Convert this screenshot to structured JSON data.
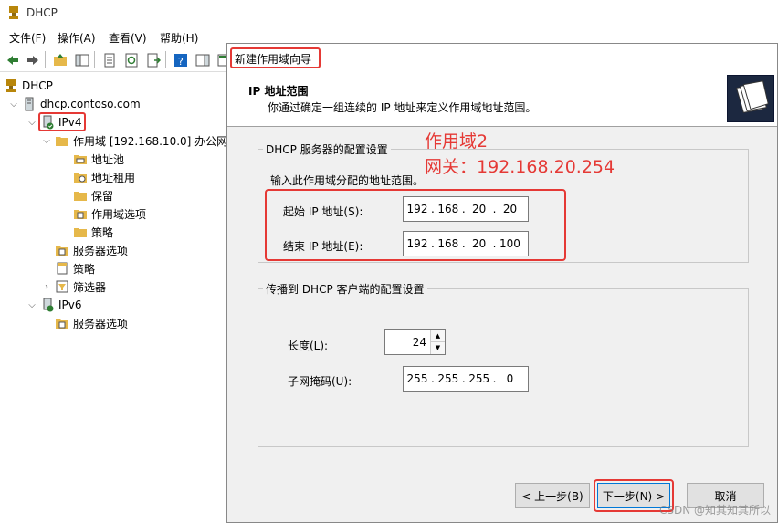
{
  "window": {
    "title": "DHCP"
  },
  "menu": [
    "文件(F)",
    "操作(A)",
    "查看(V)",
    "帮助(H)"
  ],
  "tree": {
    "root": "DHCP",
    "server": "dhcp.contoso.com",
    "ipv4": "IPv4",
    "scope": "作用域 [192.168.10.0] 办公网",
    "scope_children": [
      "地址池",
      "地址租用",
      "保留",
      "作用域选项",
      "策略"
    ],
    "ipv4_children": [
      "服务器选项",
      "策略",
      "筛选器"
    ],
    "ipv6": "IPv6",
    "ipv6_children": [
      "服务器选项"
    ]
  },
  "wizard": {
    "title": "新建作用域向导",
    "header_title": "IP 地址范围",
    "header_desc": "你通过确定一组连续的 IP 地址来定义作用域地址范围。",
    "group1_legend": "DHCP 服务器的配置设置",
    "group1_instruction": "输入此作用域分配的地址范围。",
    "start_ip_label": "起始 IP 地址(S):",
    "start_ip": [
      "192",
      "168",
      "20",
      "20"
    ],
    "end_ip_label": "结束 IP 地址(E):",
    "end_ip": [
      "192",
      "168",
      "20",
      "100"
    ],
    "group2_legend": "传播到 DHCP 客户端的配置设置",
    "length_label": "长度(L):",
    "length_value": "24",
    "mask_label": "子网掩码(U):",
    "mask": [
      "255",
      "255",
      "255",
      "0"
    ],
    "back_button": "< 上一步(B)",
    "next_button": "下一步(N) >",
    "cancel_button": "取消"
  },
  "annotation": {
    "line1": "作用域2",
    "line2": "网关：192.168.20.254"
  },
  "watermark": "CSDN @知其知其所以",
  "colors": {
    "highlight": "#e53935",
    "accent": "#0078d7"
  }
}
